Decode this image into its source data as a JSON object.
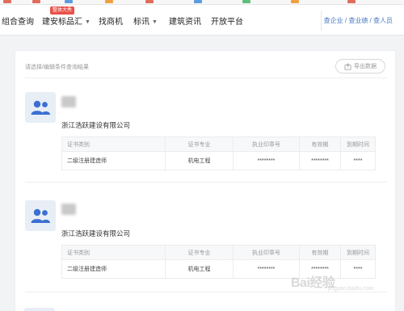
{
  "nav": {
    "items": [
      {
        "label": "组合查询",
        "has_caret": false
      },
      {
        "label": "建安标品汇",
        "has_caret": true,
        "badge": "整体大秀"
      },
      {
        "label": "找商机",
        "has_caret": false
      },
      {
        "label": "标讯",
        "has_caret": true
      },
      {
        "label": "建筑资讯",
        "has_caret": false
      },
      {
        "label": "开放平台",
        "has_caret": false
      }
    ],
    "right_links": "查企业 / 查业绩 / 查人员"
  },
  "results": {
    "prompt": "请选择/编辑条件查询结果",
    "export_label": "导出数据",
    "columns": [
      "证书类别",
      "证书专业",
      "执业印章号",
      "有效期",
      "到期时间"
    ],
    "records": [
      {
        "company": "浙江浩跃建设有限公司",
        "rows": [
          [
            "二级注册建造师",
            "机电工程",
            "********",
            "********",
            "****"
          ]
        ]
      },
      {
        "company": "浙江浩跃建设有限公司",
        "rows": [
          [
            "二级注册建造师",
            "机电工程",
            "********",
            "********",
            "****"
          ]
        ]
      }
    ]
  },
  "watermark": {
    "brand": "Bai经验",
    "sub": "jingyan.baidu.com"
  },
  "colors": {
    "accent": "#4a78c2",
    "badge": "#e8534a",
    "avatar_icon": "#3b6fd1"
  },
  "icons": {
    "avatar": "users-icon",
    "export": "export-icon"
  }
}
